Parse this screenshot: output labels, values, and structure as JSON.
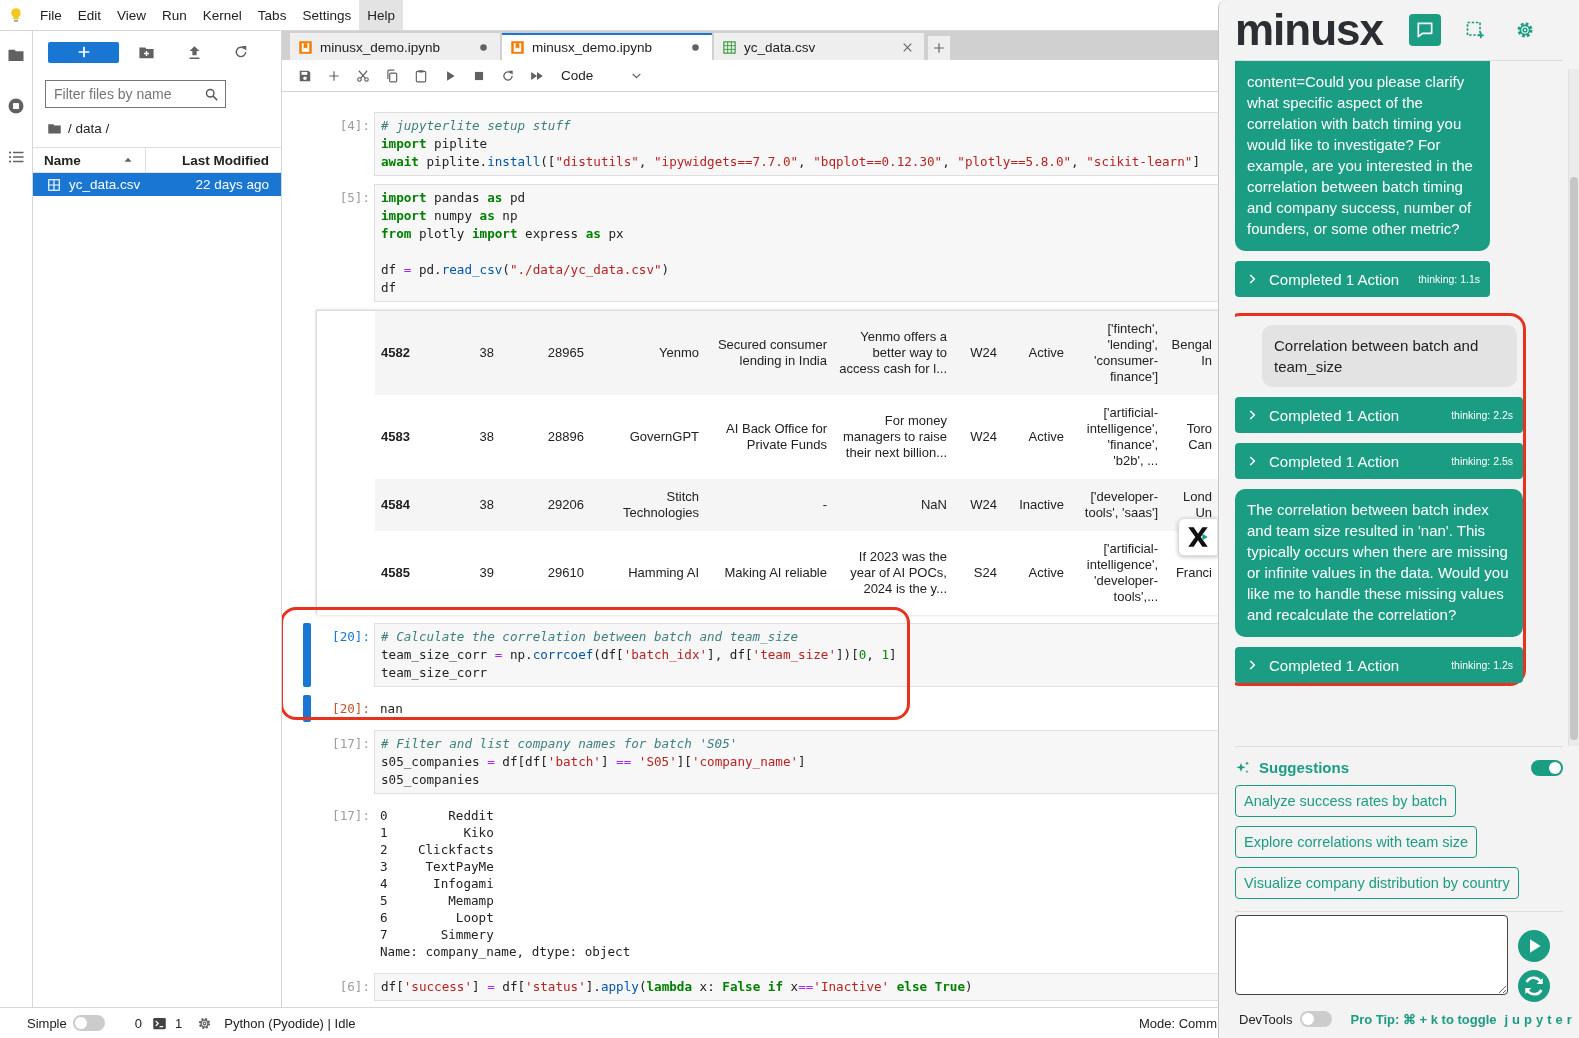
{
  "menu": [
    {
      "label": "File",
      "selected": false
    },
    {
      "label": "Edit",
      "selected": false
    },
    {
      "label": "View",
      "selected": false
    },
    {
      "label": "Run",
      "selected": false
    },
    {
      "label": "Kernel",
      "selected": false
    },
    {
      "label": "Tabs",
      "selected": false
    },
    {
      "label": "Settings",
      "selected": false
    },
    {
      "label": "Help",
      "selected": true
    }
  ],
  "file_browser": {
    "filter": {
      "placeholder": "Filter files by name"
    },
    "path": "/ data /",
    "columns": [
      "Name",
      "Last Modified"
    ],
    "files": [
      {
        "name": "yc_data.csv",
        "modified": "22 days ago",
        "selected": true
      }
    ]
  },
  "notebook": {
    "tabs": [
      {
        "label": "minusx_demo.ipynb",
        "kind": "notebook",
        "dirty": true,
        "selected": false
      },
      {
        "label": "minusx_demo.ipynb",
        "kind": "notebook",
        "dirty": true,
        "selected": true
      },
      {
        "label": "yc_data.csv",
        "kind": "csv",
        "dirty": false,
        "selected": false
      }
    ],
    "cell_type": "Code",
    "cells": [
      {
        "prompt": "[4]:",
        "active": false,
        "highlighted": false,
        "source": [
          [
            {
              "kind": "comment",
              "text": "# jupyterlite setup stuff"
            }
          ],
          [
            {
              "kind": "keyword",
              "text": "import"
            },
            {
              "kind": "plain",
              "text": " piplite"
            }
          ],
          [
            {
              "kind": "keyword",
              "text": "await"
            },
            {
              "kind": "plain",
              "text": " piplite."
            },
            {
              "kind": "function",
              "text": "install"
            },
            {
              "kind": "plain",
              "text": "(["
            },
            {
              "kind": "string",
              "text": "\"distutils\""
            },
            {
              "kind": "plain",
              "text": ", "
            },
            {
              "kind": "string",
              "text": "\"ipywidgets==7.7.0\""
            },
            {
              "kind": "plain",
              "text": ", "
            },
            {
              "kind": "string",
              "text": "\"bqplot==0.12.30\""
            },
            {
              "kind": "plain",
              "text": ", "
            },
            {
              "kind": "string",
              "text": "\"plotly==5.8.0\""
            },
            {
              "kind": "plain",
              "text": ", "
            },
            {
              "kind": "string",
              "text": "\"scikit-learn\""
            },
            {
              "kind": "plain",
              "text": "]"
            }
          ]
        ]
      },
      {
        "prompt": "[5]:",
        "active": false,
        "highlighted": false,
        "source": [
          [
            {
              "kind": "keyword",
              "text": "import"
            },
            {
              "kind": "plain",
              "text": " pandas "
            },
            {
              "kind": "keyword",
              "text": "as"
            },
            {
              "kind": "plain",
              "text": " pd"
            }
          ],
          [
            {
              "kind": "keyword",
              "text": "import"
            },
            {
              "kind": "plain",
              "text": " numpy "
            },
            {
              "kind": "keyword",
              "text": "as"
            },
            {
              "kind": "plain",
              "text": " np"
            }
          ],
          [
            {
              "kind": "keyword",
              "text": "from"
            },
            {
              "kind": "plain",
              "text": " plotly "
            },
            {
              "kind": "keyword",
              "text": "import"
            },
            {
              "kind": "plain",
              "text": " express "
            },
            {
              "kind": "keyword",
              "text": "as"
            },
            {
              "kind": "plain",
              "text": " px"
            }
          ],
          [
            {
              "kind": "blank"
            }
          ],
          [
            {
              "kind": "plain",
              "text": "df "
            },
            {
              "kind": "operator",
              "text": "="
            },
            {
              "kind": "plain",
              "text": " pd."
            },
            {
              "kind": "function",
              "text": "read_csv"
            },
            {
              "kind": "plain",
              "text": "("
            },
            {
              "kind": "string",
              "text": "\"./data/yc_data.csv\""
            },
            {
              "kind": "plain",
              "text": ")"
            }
          ],
          [
            {
              "kind": "plain",
              "text": "df"
            }
          ]
        ],
        "output": {
          "kind": "table",
          "rows": [
            {
              "index": "4582",
              "cells": [
                "38",
                "28965",
                "Yenmo",
                "Secured consumer lending in India",
                "Yenmo offers a better way to access cash for l...",
                "W24",
                "Active",
                "['fintech', 'lending', 'consumer-finance']",
                "Bengal\nIn"
              ]
            },
            {
              "index": "4583",
              "cells": [
                "38",
                "28896",
                "GovernGPT",
                "AI Back Office for Private Funds",
                "For money managers to raise their next billion...",
                "W24",
                "Active",
                "['artificial-intelligence', 'finance', 'b2b', ...",
                "Toro\nCan"
              ]
            },
            {
              "index": "4584",
              "cells": [
                "38",
                "29206",
                "Stitch Technologies",
                "-",
                "NaN",
                "W24",
                "Inactive",
                "['developer-tools', 'saas']",
                "Lond\nUn"
              ]
            },
            {
              "index": "4585",
              "cells": [
                "39",
                "29610",
                "Hamming AI",
                "Making AI reliable",
                "If 2023 was the year of AI POCs, 2024 is the y...",
                "S24",
                "Active",
                "['artificial-intelligence', 'developer-tools',...",
                "Franci"
              ]
            }
          ]
        }
      },
      {
        "prompt": "[20]:",
        "active": true,
        "highlighted": true,
        "source": [
          [
            {
              "kind": "comment",
              "text": "# Calculate the correlation between batch and team_size"
            }
          ],
          [
            {
              "kind": "plain",
              "text": "team_size_corr "
            },
            {
              "kind": "operator",
              "text": "="
            },
            {
              "kind": "plain",
              "text": " np."
            },
            {
              "kind": "function",
              "text": "corrcoef"
            },
            {
              "kind": "plain",
              "text": "(df["
            },
            {
              "kind": "string",
              "text": "'batch_idx'"
            },
            {
              "kind": "plain",
              "text": "], df["
            },
            {
              "kind": "string",
              "text": "'team_size'"
            },
            {
              "kind": "plain",
              "text": "])["
            },
            {
              "kind": "number",
              "text": "0"
            },
            {
              "kind": "plain",
              "text": ", "
            },
            {
              "kind": "number",
              "text": "1"
            },
            {
              "kind": "plain",
              "text": "]"
            }
          ],
          [
            {
              "kind": "plain",
              "text": "team_size_corr"
            }
          ]
        ],
        "output": {
          "kind": "text",
          "prompt": "[20]:",
          "lines": [
            "nan"
          ]
        }
      },
      {
        "prompt": "[17]:",
        "active": false,
        "highlighted": false,
        "source": [
          [
            {
              "kind": "comment",
              "text": "# Filter and list company names for batch 'S05'"
            }
          ],
          [
            {
              "kind": "plain",
              "text": "s05_companies "
            },
            {
              "kind": "operator",
              "text": "="
            },
            {
              "kind": "plain",
              "text": " df[df["
            },
            {
              "kind": "string",
              "text": "'batch'"
            },
            {
              "kind": "plain",
              "text": "]"
            },
            {
              "kind": "operator",
              "text": " == "
            },
            {
              "kind": "string",
              "text": "'S05'"
            },
            {
              "kind": "plain",
              "text": "]["
            },
            {
              "kind": "string",
              "text": "'company_name'"
            },
            {
              "kind": "plain",
              "text": "]"
            }
          ],
          [
            {
              "kind": "plain",
              "text": "s05_companies"
            }
          ]
        ],
        "output": {
          "kind": "text",
          "prompt": "[17]:",
          "lines": [
            "0        Reddit",
            "1          Kiko",
            "2    Clickfacts",
            "3     TextPayMe",
            "4      Infogami",
            "5        Memamp",
            "6         Loopt",
            "7       Simmery",
            "Name: company_name, dtype: object"
          ]
        }
      },
      {
        "prompt": "[6]:",
        "active": false,
        "highlighted": false,
        "source": [
          [
            {
              "kind": "plain",
              "text": "df["
            },
            {
              "kind": "string",
              "text": "'success'"
            },
            {
              "kind": "plain",
              "text": "] "
            },
            {
              "kind": "operator",
              "text": "="
            },
            {
              "kind": "plain",
              "text": " df["
            },
            {
              "kind": "string",
              "text": "'status'"
            },
            {
              "kind": "plain",
              "text": "]."
            },
            {
              "kind": "function",
              "text": "apply"
            },
            {
              "kind": "plain",
              "text": "("
            },
            {
              "kind": "keyword",
              "text": "lambda"
            },
            {
              "kind": "plain",
              "text": " x: "
            },
            {
              "kind": "keyword",
              "text": "False if"
            },
            {
              "kind": "plain",
              "text": " x"
            },
            {
              "kind": "operator",
              "text": "=="
            },
            {
              "kind": "string",
              "text": "'Inactive' "
            },
            {
              "kind": "keyword",
              "text": "else True"
            },
            {
              "kind": "plain",
              "text": ")"
            }
          ]
        ]
      }
    ]
  },
  "status_bar": {
    "simple_mode": {
      "label": "Simple",
      "on": false
    },
    "terminals": "0",
    "kernels": "1",
    "kernel": "Python (Pyodide) | Idle",
    "mode": "Mode: Comm"
  },
  "assistant": {
    "logo": "minusx",
    "views": [
      {
        "kind": "chat",
        "selected": true
      },
      {
        "kind": "select",
        "selected": false
      },
      {
        "kind": "settings",
        "selected": false
      }
    ],
    "messages": [
      {
        "kind": "assistant",
        "text": "content=Could you please clarify what specific aspect of the correlation with batch timing you would like to investigate? For example, are you interested in the correlation between batch timing and company success, number of founders, or some other metric?"
      },
      {
        "kind": "action",
        "label": "Completed 1 Action",
        "thinking": "thinking: 1.1s"
      }
    ],
    "highlighted_messages": [
      {
        "kind": "user",
        "text": "Correlation between batch and team_size"
      },
      {
        "kind": "action",
        "label": "Completed 1 Action",
        "thinking": "thinking: 2.2s"
      },
      {
        "kind": "action",
        "label": "Completed 1 Action",
        "thinking": "thinking: 2.5s"
      },
      {
        "kind": "assistant",
        "text": "The correlation between batch index and team size resulted in 'nan'. This typically occurs when there are missing or infinite values in the data. Would you like me to handle these missing values and recalculate the correlation?"
      },
      {
        "kind": "action",
        "label": "Completed 1 Action",
        "thinking": "thinking: 1.2s"
      }
    ],
    "suggestions": {
      "title": "Suggestions",
      "on": true,
      "items": [
        "Analyze success rates by batch",
        "Explore correlations with team size",
        "Visualize company distribution by country"
      ]
    },
    "devtools": {
      "label": "DevTools",
      "on": false
    },
    "tip": "Pro Tip: ⌘ + k to toggle",
    "brand": "jupyter"
  }
}
